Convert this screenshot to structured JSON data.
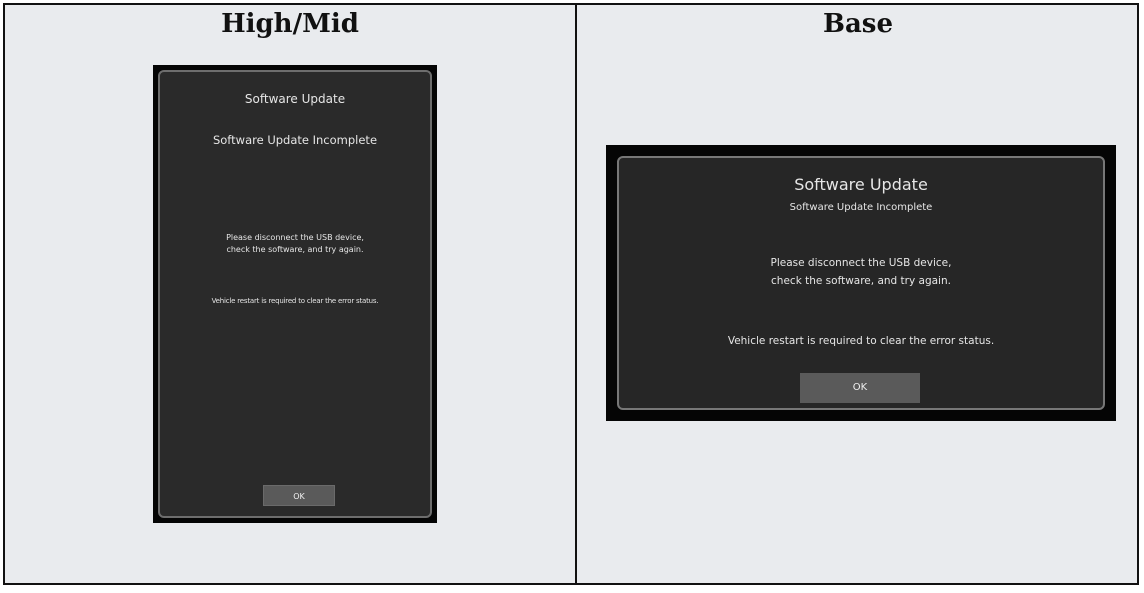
{
  "columns": {
    "left_title": "High/Mid",
    "right_title": "Base"
  },
  "high_mid_screen": {
    "title": "Software Update",
    "status": "Software Update Incomplete",
    "message_line1": "Please disconnect the USB device,",
    "message_line2": "check the software, and try again.",
    "note": "Vehicle restart is required to clear the error status.",
    "ok_label": "OK"
  },
  "base_screen": {
    "title": "Software Update",
    "status": "Software Update Incomplete",
    "message_line1": "Please disconnect the USB device,",
    "message_line2": "check the software, and try again.",
    "note": "Vehicle restart is required to clear the error status.",
    "ok_label": "OK"
  },
  "colors": {
    "panel_background": "#2a2a2a",
    "button_background": "#5a5a5a",
    "page_background": "#e9ebee"
  }
}
